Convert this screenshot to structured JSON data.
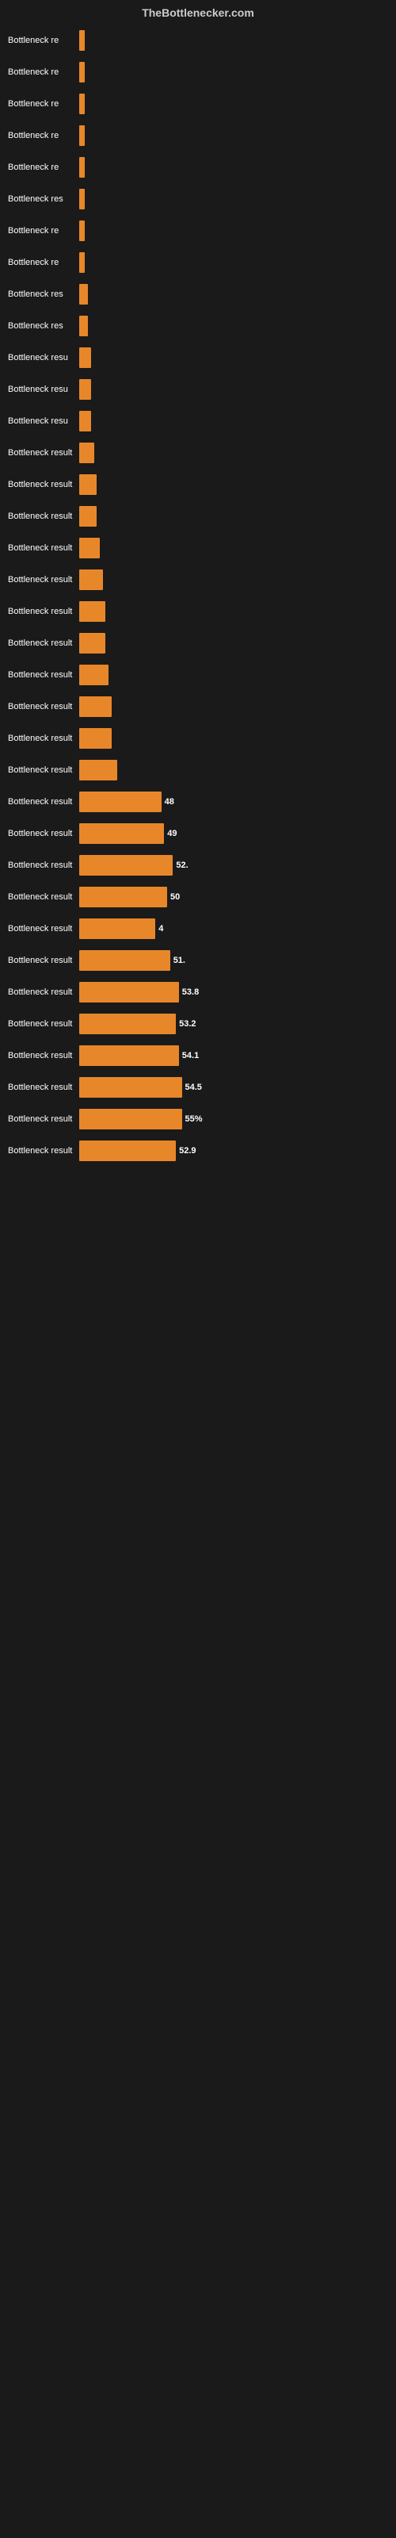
{
  "header": {
    "title": "TheBottlenecker.com"
  },
  "rows": [
    {
      "label": "Bottleneck re",
      "value": null,
      "width_pct": 2
    },
    {
      "label": "Bottleneck re",
      "value": null,
      "width_pct": 2
    },
    {
      "label": "Bottleneck re",
      "value": null,
      "width_pct": 2
    },
    {
      "label": "Bottleneck re",
      "value": null,
      "width_pct": 2
    },
    {
      "label": "Bottleneck re",
      "value": null,
      "width_pct": 2
    },
    {
      "label": "Bottleneck res",
      "value": null,
      "width_pct": 2
    },
    {
      "label": "Bottleneck re",
      "value": null,
      "width_pct": 2
    },
    {
      "label": "Bottleneck re",
      "value": null,
      "width_pct": 2
    },
    {
      "label": "Bottleneck res",
      "value": null,
      "width_pct": 3
    },
    {
      "label": "Bottleneck res",
      "value": null,
      "width_pct": 3
    },
    {
      "label": "Bottleneck resu",
      "value": null,
      "width_pct": 4
    },
    {
      "label": "Bottleneck resu",
      "value": null,
      "width_pct": 4
    },
    {
      "label": "Bottleneck resu",
      "value": null,
      "width_pct": 4
    },
    {
      "label": "Bottleneck result",
      "value": null,
      "width_pct": 5
    },
    {
      "label": "Bottleneck result",
      "value": null,
      "width_pct": 6
    },
    {
      "label": "Bottleneck result",
      "value": null,
      "width_pct": 6
    },
    {
      "label": "Bottleneck result",
      "value": null,
      "width_pct": 7
    },
    {
      "label": "Bottleneck result",
      "value": null,
      "width_pct": 8
    },
    {
      "label": "Bottleneck result",
      "value": null,
      "width_pct": 9
    },
    {
      "label": "Bottleneck result",
      "value": null,
      "width_pct": 9
    },
    {
      "label": "Bottleneck result",
      "value": null,
      "width_pct": 10
    },
    {
      "label": "Bottleneck result",
      "value": null,
      "width_pct": 11
    },
    {
      "label": "Bottleneck result",
      "value": null,
      "width_pct": 11
    },
    {
      "label": "Bottleneck result",
      "value": null,
      "width_pct": 13
    },
    {
      "label": "Bottleneck result",
      "value": "48",
      "width_pct": 28
    },
    {
      "label": "Bottleneck result",
      "value": "49",
      "width_pct": 29
    },
    {
      "label": "Bottleneck result",
      "value": "52.",
      "width_pct": 32
    },
    {
      "label": "Bottleneck result",
      "value": "50",
      "width_pct": 30
    },
    {
      "label": "Bottleneck result",
      "value": "4",
      "width_pct": 26
    },
    {
      "label": "Bottleneck result",
      "value": "51.",
      "width_pct": 31
    },
    {
      "label": "Bottleneck result",
      "value": "53.8",
      "width_pct": 34
    },
    {
      "label": "Bottleneck result",
      "value": "53.2",
      "width_pct": 33
    },
    {
      "label": "Bottleneck result",
      "value": "54.1",
      "width_pct": 34
    },
    {
      "label": "Bottleneck result",
      "value": "54.5",
      "width_pct": 35
    },
    {
      "label": "Bottleneck result",
      "value": "55%",
      "width_pct": 35
    },
    {
      "label": "Bottleneck result",
      "value": "52.9",
      "width_pct": 33
    }
  ]
}
